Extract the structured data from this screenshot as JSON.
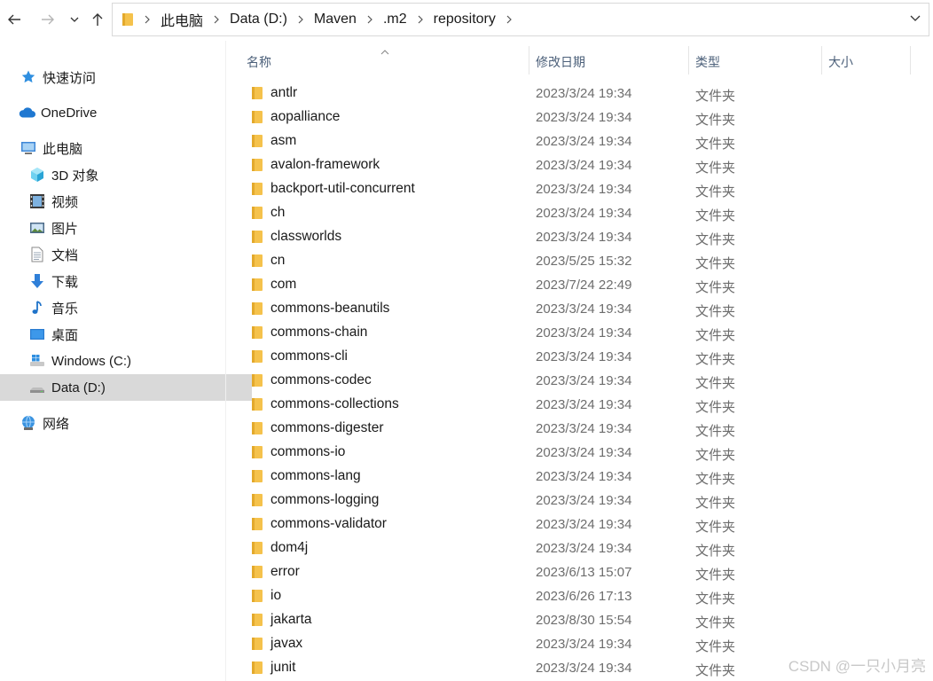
{
  "nav": {
    "back_icon": "arrow-left-icon",
    "forward_icon": "arrow-right-icon",
    "recent_icon": "chevron-down-icon",
    "up_icon": "arrow-up-icon"
  },
  "address": {
    "crumbs": [
      "此电脑",
      "Data (D:)",
      "Maven",
      ".m2",
      "repository"
    ],
    "dropdown_icon": "chevron-down-icon"
  },
  "sidebar": {
    "items": [
      {
        "label": "快速访问",
        "icon": "star-icon"
      },
      {
        "label": "OneDrive",
        "icon": "cloud-icon"
      },
      {
        "label": "此电脑",
        "icon": "computer-icon"
      },
      {
        "label": "3D 对象",
        "icon": "cube-icon"
      },
      {
        "label": "视频",
        "icon": "film-icon"
      },
      {
        "label": "图片",
        "icon": "picture-icon"
      },
      {
        "label": "文档",
        "icon": "document-icon"
      },
      {
        "label": "下载",
        "icon": "download-icon"
      },
      {
        "label": "音乐",
        "icon": "music-note-icon"
      },
      {
        "label": "桌面",
        "icon": "desktop-icon"
      },
      {
        "label": "Windows (C:)",
        "icon": "windows-drive-icon"
      },
      {
        "label": "Data (D:)",
        "icon": "drive-icon",
        "selected": true
      },
      {
        "label": "网络",
        "icon": "network-icon"
      }
    ]
  },
  "columns": {
    "name": "名称",
    "date": "修改日期",
    "type": "类型",
    "size": "大小"
  },
  "files": [
    {
      "name": "antlr",
      "date": "2023/3/24 19:34",
      "type": "文件夹"
    },
    {
      "name": "aopalliance",
      "date": "2023/3/24 19:34",
      "type": "文件夹"
    },
    {
      "name": "asm",
      "date": "2023/3/24 19:34",
      "type": "文件夹"
    },
    {
      "name": "avalon-framework",
      "date": "2023/3/24 19:34",
      "type": "文件夹"
    },
    {
      "name": "backport-util-concurrent",
      "date": "2023/3/24 19:34",
      "type": "文件夹"
    },
    {
      "name": "ch",
      "date": "2023/3/24 19:34",
      "type": "文件夹"
    },
    {
      "name": "classworlds",
      "date": "2023/3/24 19:34",
      "type": "文件夹"
    },
    {
      "name": "cn",
      "date": "2023/5/25 15:32",
      "type": "文件夹"
    },
    {
      "name": "com",
      "date": "2023/7/24 22:49",
      "type": "文件夹"
    },
    {
      "name": "commons-beanutils",
      "date": "2023/3/24 19:34",
      "type": "文件夹"
    },
    {
      "name": "commons-chain",
      "date": "2023/3/24 19:34",
      "type": "文件夹"
    },
    {
      "name": "commons-cli",
      "date": "2023/3/24 19:34",
      "type": "文件夹"
    },
    {
      "name": "commons-codec",
      "date": "2023/3/24 19:34",
      "type": "文件夹"
    },
    {
      "name": "commons-collections",
      "date": "2023/3/24 19:34",
      "type": "文件夹"
    },
    {
      "name": "commons-digester",
      "date": "2023/3/24 19:34",
      "type": "文件夹"
    },
    {
      "name": "commons-io",
      "date": "2023/3/24 19:34",
      "type": "文件夹"
    },
    {
      "name": "commons-lang",
      "date": "2023/3/24 19:34",
      "type": "文件夹"
    },
    {
      "name": "commons-logging",
      "date": "2023/3/24 19:34",
      "type": "文件夹"
    },
    {
      "name": "commons-validator",
      "date": "2023/3/24 19:34",
      "type": "文件夹"
    },
    {
      "name": "dom4j",
      "date": "2023/3/24 19:34",
      "type": "文件夹"
    },
    {
      "name": "error",
      "date": "2023/6/13 15:07",
      "type": "文件夹"
    },
    {
      "name": "io",
      "date": "2023/6/26 17:13",
      "type": "文件夹"
    },
    {
      "name": "jakarta",
      "date": "2023/8/30 15:54",
      "type": "文件夹"
    },
    {
      "name": "javax",
      "date": "2023/3/24 19:34",
      "type": "文件夹"
    },
    {
      "name": "junit",
      "date": "2023/3/24 19:34",
      "type": "文件夹"
    }
  ],
  "watermark": "CSDN @一只小月亮",
  "colors": {
    "folder": "#f5c24c",
    "folder_dark": "#e3a92c",
    "selection": "#d9d9d9",
    "header_text": "#4c607a"
  }
}
